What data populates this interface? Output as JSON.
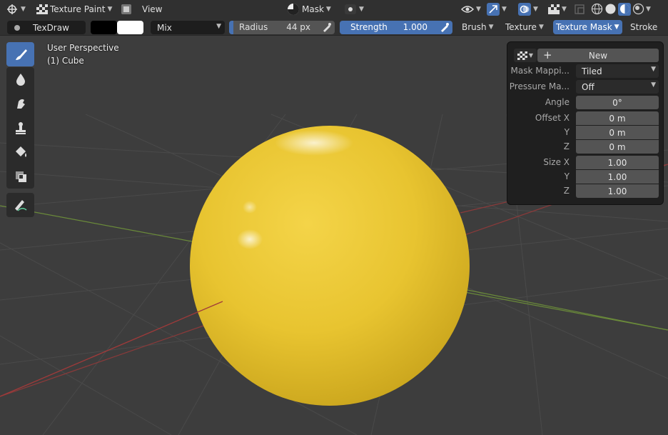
{
  "header": {
    "mode_label": "Texture Paint",
    "view_label": "View",
    "mask_label": "Mask"
  },
  "tool_settings": {
    "brush_name": "TexDraw",
    "blend_mode": "Mix",
    "radius_label": "Radius",
    "radius_value": "44 px",
    "strength_label": "Strength",
    "strength_value": "1.000",
    "brush_menu": "Brush",
    "texture_menu": "Texture",
    "texture_mask_menu": "Texture Mask",
    "stroke_menu": "Stroke",
    "primary_color": "#000000",
    "secondary_color": "#ffffff",
    "accent_color": "#4772b3"
  },
  "viewport": {
    "perspective": "User Perspective",
    "object": "(1) Cube",
    "sphere_color": "#e8c430"
  },
  "toolbar": {
    "tools": [
      "draw-brush-icon",
      "soften-icon",
      "smear-icon",
      "clone-icon",
      "fill-icon",
      "mask-icon",
      "annotate-icon"
    ]
  },
  "texture_mask_panel": {
    "new_label": "New",
    "mask_mapping_label": "Mask Mappi...",
    "mask_mapping_value": "Tiled",
    "pressure_label": "Pressure Ma...",
    "pressure_value": "Off",
    "angle_label": "Angle",
    "angle_value": "0°",
    "offset_x_label": "Offset X",
    "offset_x_value": "0 m",
    "offset_y_label": "Y",
    "offset_y_value": "0 m",
    "offset_z_label": "Z",
    "offset_z_value": "0 m",
    "size_x_label": "Size X",
    "size_x_value": "1.00",
    "size_y_label": "Y",
    "size_y_value": "1.00",
    "size_z_label": "Z",
    "size_z_value": "1.00"
  }
}
